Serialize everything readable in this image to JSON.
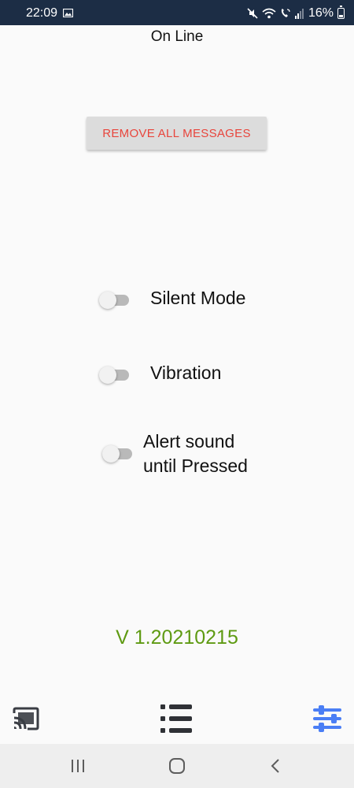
{
  "status_bar": {
    "time": "22:09",
    "battery": "16%",
    "icons": [
      "gallery-icon",
      "mute-icon",
      "wifi-icon",
      "wifi-calling-icon",
      "signal-icon",
      "battery-icon"
    ]
  },
  "header": {
    "connection_status": "On Line"
  },
  "actions": {
    "remove_all_label": "REMOVE ALL MESSAGES"
  },
  "settings": {
    "silent_mode": {
      "label": "Silent Mode",
      "enabled": false
    },
    "vibration": {
      "label": "Vibration",
      "enabled": false
    },
    "alert_sound": {
      "label_line1": "Alert sound",
      "label_line2": "until Pressed",
      "enabled": false
    }
  },
  "footer": {
    "version": "V 1.20210215"
  },
  "bottom_nav": {
    "items": [
      "cast-icon",
      "list-icon",
      "settings-sliders-icon"
    ],
    "active": "settings-sliders-icon"
  },
  "colors": {
    "status_bar_bg": "#1c2d45",
    "button_text": "#e8453c",
    "version_text": "#5e9a12",
    "active_nav": "#4a7ef5"
  }
}
